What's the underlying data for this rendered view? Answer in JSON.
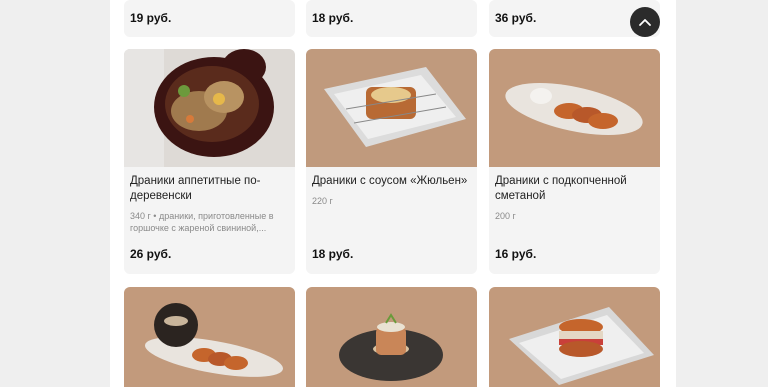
{
  "top_row_prices": [
    "19 руб.",
    "18 руб.",
    "36 руб."
  ],
  "products": [
    {
      "title": "Драники аппетитные по-деревенски",
      "weight_desc": "340 г • драники, приготовленные в горшочке с жареной свининой,...",
      "price": "26 руб.",
      "image_icon": "clay-pot-dish-icon"
    },
    {
      "title": "Драники с соусом «Жюльен»",
      "weight_desc": "220 г",
      "price": "18 руб.",
      "image_icon": "julienne-toast-icon"
    },
    {
      "title": "Драники с подкопченной сметаной",
      "weight_desc": "200 г",
      "price": "16 руб.",
      "image_icon": "potato-pancakes-plate-icon"
    }
  ],
  "bottom_row_images": [
    "pot-and-pancakes-icon",
    "layered-stack-plate-icon",
    "burger-on-newspaper-icon"
  ],
  "colors": {
    "page_bg": "#efefef",
    "card_bg": "#f4f4f4",
    "photo_bg": "#c29a7c",
    "button_bg": "#2b2b2b"
  }
}
